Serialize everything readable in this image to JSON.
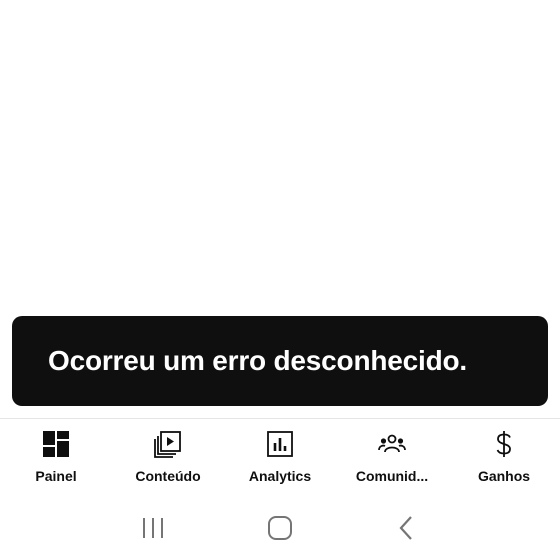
{
  "snackbar": {
    "message": "Ocorreu um erro desconhecido."
  },
  "bottom_nav": {
    "items": [
      {
        "label": "Painel",
        "icon": "dashboard-icon"
      },
      {
        "label": "Conteúdo",
        "icon": "content-library-icon"
      },
      {
        "label": "Analytics",
        "icon": "analytics-chart-icon"
      },
      {
        "label": "Comunid...",
        "icon": "community-icon"
      },
      {
        "label": "Ganhos",
        "icon": "dollar-icon"
      }
    ]
  },
  "system_nav": {
    "buttons": [
      "recent-apps-icon",
      "home-icon",
      "back-icon"
    ]
  },
  "colors": {
    "snackbar_bg": "#0f0f0f",
    "snackbar_text": "#ffffff",
    "nav_text": "#0f0f0f",
    "system_nav_icon": "#757575"
  }
}
